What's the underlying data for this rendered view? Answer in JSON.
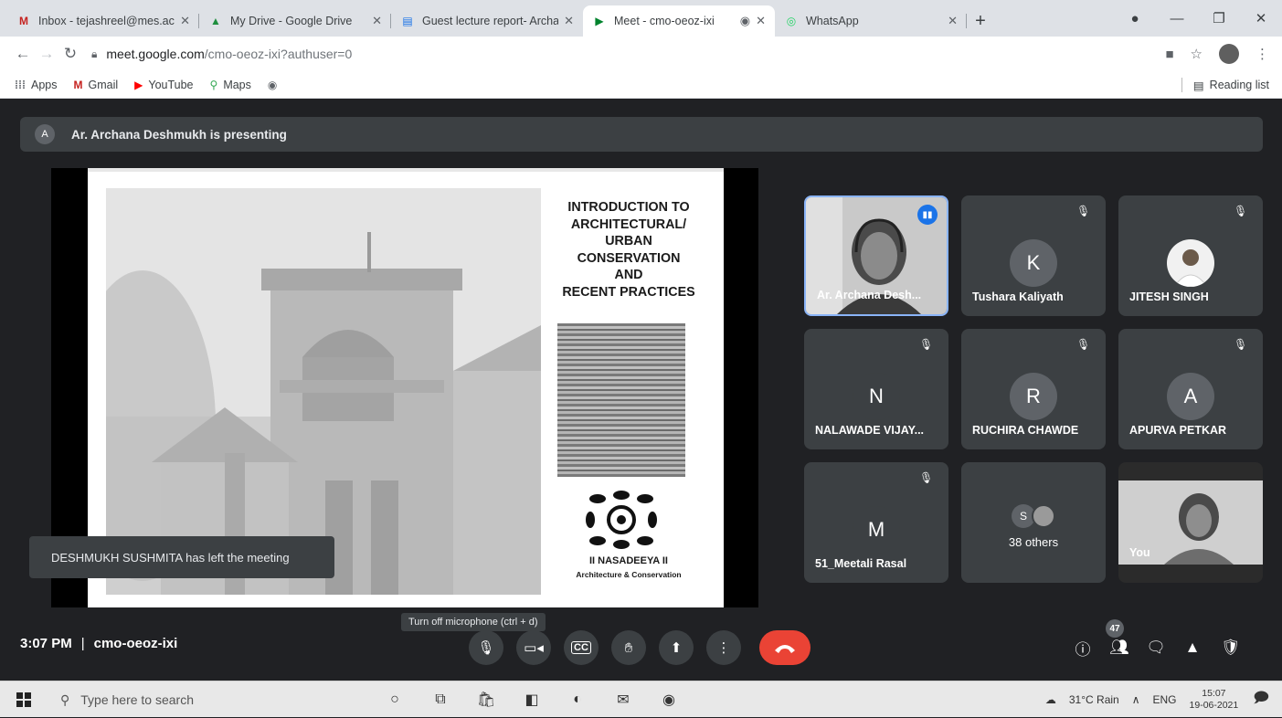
{
  "browser": {
    "tabs": [
      {
        "title": "Inbox - tejashreel@mes.ac.in",
        "icon": "gmail-icon",
        "glyph": "M",
        "color": "#c5221f"
      },
      {
        "title": "My Drive - Google Drive",
        "icon": "drive-icon",
        "glyph": "▲",
        "color": "#1e8e3e"
      },
      {
        "title": "Guest lecture report- Archana",
        "icon": "docs-icon",
        "glyph": "▤",
        "color": "#1a73e8"
      },
      {
        "title": "Meet - cmo-oeoz-ixi",
        "icon": "meet-icon",
        "glyph": "▶",
        "color": "#00832d"
      },
      {
        "title": "WhatsApp",
        "icon": "whatsapp-icon",
        "glyph": "◎",
        "color": "#25d366"
      }
    ],
    "url_host": "meet.google.com",
    "url_path": "/cmo-oeoz-ixi?authuser=0",
    "bookmarks": [
      {
        "label": "Apps",
        "icon": "apps-grid-icon",
        "glyph": "⋮⋮"
      },
      {
        "label": "Gmail",
        "icon": "gmail-icon",
        "glyph": "M"
      },
      {
        "label": "YouTube",
        "icon": "youtube-icon",
        "glyph": "▶"
      },
      {
        "label": "Maps",
        "icon": "maps-pin-icon",
        "glyph": "⚲"
      },
      {
        "label": "",
        "icon": "globe-icon",
        "glyph": "◉"
      }
    ],
    "reading_list": "Reading list"
  },
  "meet": {
    "presenting_initial": "A",
    "presenting_text": "Ar. Archana Deshmukh is presenting",
    "slide": {
      "title_lines": [
        "INTRODUCTION TO",
        "ARCHITECTURAL/",
        "URBAN",
        "CONSERVATION",
        "AND",
        "RECENT PRACTICES"
      ],
      "brand": "II NASADEEYA II",
      "brand_sub": "Architecture & Conservation"
    },
    "toast": "DESHMUKH SUSHMITA has left the meeting",
    "tiles": [
      {
        "name": "Ar. Archana Desh...",
        "type": "video",
        "speaking": true
      },
      {
        "name": "Tushara Kaliyath",
        "initial": "K",
        "color": "#e8710a",
        "muted": true
      },
      {
        "name": "JITESH SINGH",
        "type": "photo",
        "muted": true
      },
      {
        "name": "NALAWADE VIJAY...",
        "initial": "N",
        "color": "#3c4043",
        "muted": true
      },
      {
        "name": "RUCHIRA CHAWDE",
        "initial": "R",
        "color": "#5f6368",
        "muted": true
      },
      {
        "name": "APURVA PETKAR",
        "initial": "A",
        "color": "#5f6368",
        "muted": true
      },
      {
        "name": "51_Meetali Rasal",
        "initial": "M",
        "color": "#3c4043",
        "muted": true
      },
      {
        "name": "38 others",
        "initial": "S",
        "type": "others"
      },
      {
        "name": "You",
        "type": "self"
      }
    ],
    "time": "3:07 PM",
    "meeting_code": "cmo-oeoz-ixi",
    "mic_tooltip": "Turn off microphone (ctrl + d)",
    "participant_count": "47"
  },
  "taskbar": {
    "search_placeholder": "Type here to search",
    "weather": "31°C Rain",
    "lang": "ENG",
    "clock_time": "15:07",
    "clock_date": "19-06-2021"
  }
}
